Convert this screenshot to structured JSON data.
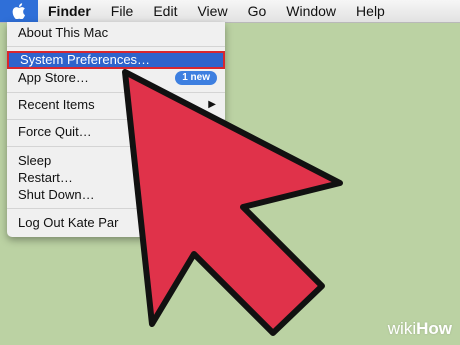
{
  "menubar": {
    "items": [
      "Finder",
      "File",
      "Edit",
      "View",
      "Go",
      "Window",
      "Help"
    ]
  },
  "apple_menu": {
    "about": "About This Mac",
    "system_preferences": "System Preferences…",
    "app_store": "App Store…",
    "app_store_badge": "1 new",
    "recent_items": "Recent Items",
    "force_quit": "Force Quit…",
    "sleep": "Sleep",
    "restart": "Restart…",
    "shut_down": "Shut Down…",
    "log_out": "Log Out Kate Par"
  },
  "watermark": {
    "part1": "wiki",
    "part2": "How"
  },
  "colors": {
    "highlight": "#2e63cc",
    "highlight_outline": "#d8262e",
    "cursor": "#e0324a",
    "desktop": "#bbd2a3"
  },
  "icons": [
    "apple-logo-icon",
    "chevron-right-icon",
    "force-quit-shortcut-icon",
    "pointer-cursor-icon"
  ]
}
